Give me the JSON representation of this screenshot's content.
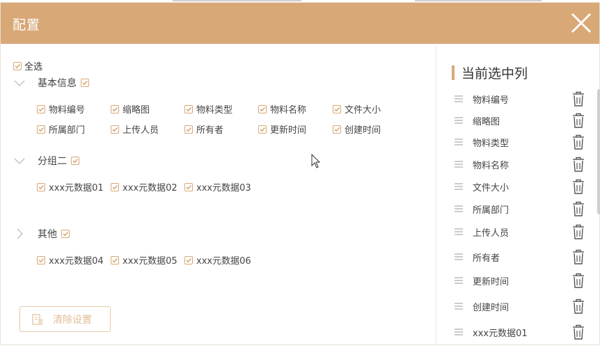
{
  "dialog": {
    "title": "配置"
  },
  "left_panel": {
    "select_all_label": "全选",
    "groups": [
      {
        "name": "基本信息",
        "expanded": true,
        "fields": [
          "物料编号",
          "缩略图",
          "物料类型",
          "物料名称",
          "文件大小",
          "所属部门",
          "上传人员",
          "所有者",
          "更新时间",
          "创建时间"
        ]
      },
      {
        "name": "分组二",
        "expanded": true,
        "fields": [
          "xxx元数据01",
          "xxx元数据02",
          "xxx元数据03"
        ]
      },
      {
        "name": "其他",
        "expanded": false,
        "fields": [
          "xxx元数据04",
          "xxx元数据05",
          "xxx元数据06"
        ]
      }
    ],
    "clear_button_label": "清除设置"
  },
  "right_panel": {
    "title": "当前选中列",
    "columns": [
      "物料编号",
      "缩略图",
      "物料类型",
      "物料名称",
      "文件大小",
      "所属部门",
      "上传人员",
      "所有者",
      "更新时间",
      "创建时间",
      "xxx元数据01"
    ]
  },
  "colors": {
    "accent": "#d8a877",
    "header_bg": "#d8a877",
    "button_text": "#e0bd96"
  },
  "icons": {
    "close": "close-icon",
    "chevron": "chevron-icon",
    "drag": "drag-handle-icon",
    "trash": "trash-icon",
    "clear": "broom-icon"
  }
}
